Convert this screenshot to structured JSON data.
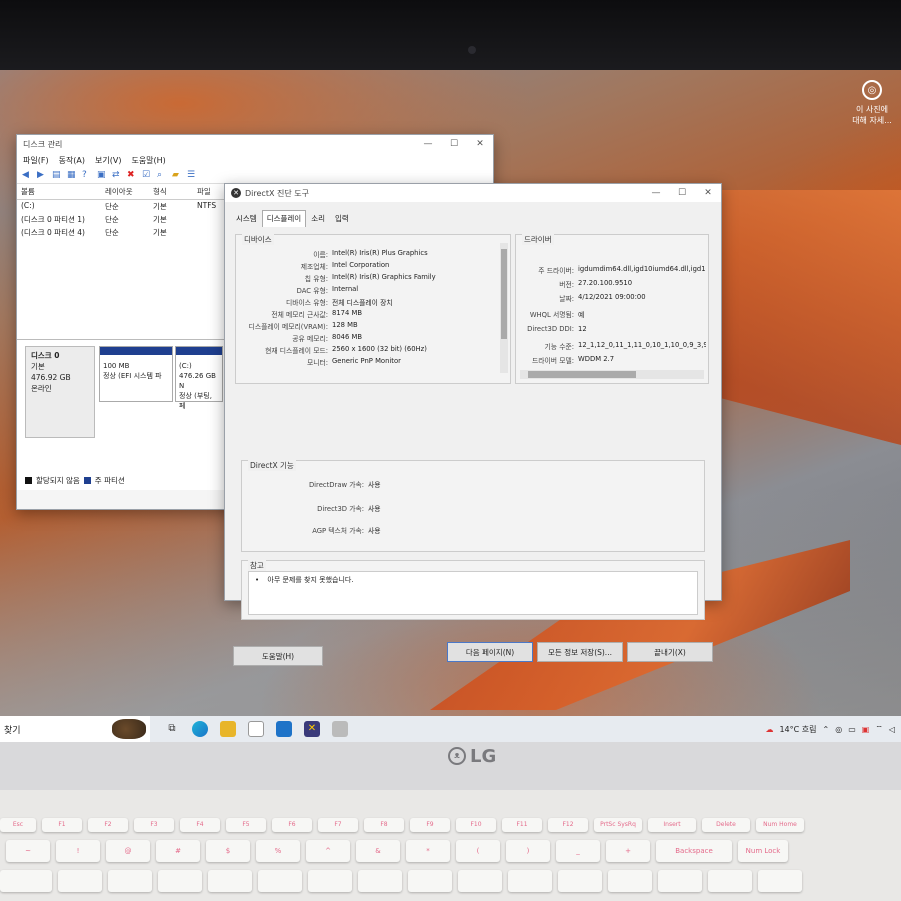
{
  "photo_overlay": {
    "line1": "이 사진에",
    "line2": "대해 자세..."
  },
  "disk_window": {
    "title": "디스크 관리",
    "menu": [
      "파일(F)",
      "동작(A)",
      "보기(V)",
      "도움말(H)"
    ],
    "columns": [
      "볼륨",
      "레이아웃",
      "형식",
      "파일"
    ],
    "rows": [
      [
        "(C:)",
        "단순",
        "기본",
        "NTFS"
      ],
      [
        "(디스크 0 파티션 1)",
        "단순",
        "기본",
        ""
      ],
      [
        "(디스크 0 파티션 4)",
        "단순",
        "기본",
        ""
      ]
    ],
    "disk": {
      "name": "디스크 0",
      "type": "기본",
      "size": "476.92 GB",
      "status": "온라인"
    },
    "partitions": [
      {
        "name": "",
        "size": "100 MB",
        "status": "정상 (EFI 시스템 파"
      },
      {
        "name": "(C:)",
        "size": "476.26 GB N",
        "status": "정상 (부팅, 페"
      }
    ],
    "legend": [
      "할당되지 않음",
      "주 파티션"
    ]
  },
  "dx_window": {
    "title": "DirectX 진단 도구",
    "tabs": [
      "시스템",
      "디스플레이",
      "소리",
      "입력"
    ],
    "device_group": "디바이스",
    "device": [
      [
        "이름:",
        "Intel(R) Iris(R) Plus Graphics"
      ],
      [
        "제조업체:",
        "Intel Corporation"
      ],
      [
        "칩 유형:",
        "Intel(R) Iris(R) Graphics Family"
      ],
      [
        "DAC 유형:",
        "Internal"
      ],
      [
        "디바이스 유형:",
        "전체 디스플레이 장치"
      ],
      [
        "전체 메모리 근사값:",
        "8174 MB"
      ],
      [
        "디스플레이 메모리(VRAM):",
        "128 MB"
      ],
      [
        "공유 메모리:",
        "8046 MB"
      ],
      [
        "현재 디스플레이 모드:",
        "2560 x 1600 (32 bit) (60Hz)"
      ],
      [
        "모니터:",
        "Generic PnP Monitor"
      ]
    ],
    "driver_group": "드라이버",
    "driver": [
      [
        "주 드라이버:",
        "igdumdim64.dll,igd10iumd64.dll,igd10"
      ],
      [
        "버전:",
        "27.20.100.9510"
      ],
      [
        "날짜:",
        "4/12/2021 09:00:00"
      ],
      [
        "WHQL 서명됨:",
        "예"
      ],
      [
        "Direct3D DDI:",
        "12"
      ],
      [
        "기능 수준:",
        "12_1,12_0,11_1,11_0,10_1,10_0,9_3,9_"
      ],
      [
        "드라이버 모델:",
        "WDDM 2.7"
      ]
    ],
    "features_group": "DirectX 기능",
    "features": [
      [
        "DirectDraw 가속:",
        "사용"
      ],
      [
        "Direct3D 가속:",
        "사용"
      ],
      [
        "AGP 텍스처 가속:",
        "사용"
      ]
    ],
    "notes_group": "참고",
    "notes": "아무 문제를 찾지 못했습니다.",
    "buttons": {
      "help": "도움말(H)",
      "next": "다음 페이지(N)",
      "save": "모든 정보 저장(S)...",
      "exit": "끝내기(X)"
    }
  },
  "taskbar": {
    "search": "찾기",
    "weather": "14°C 흐림"
  },
  "brand": "LG",
  "keys_fn": [
    "Esc",
    "F1",
    "F2",
    "F3",
    "F4",
    "F5",
    "F6",
    "F7",
    "F8",
    "F9",
    "F10",
    "F11",
    "F12",
    "PrtSc SysRq",
    "Insert",
    "Delete",
    "Num Home"
  ],
  "keys_num": [
    "~",
    "!",
    "@",
    "#",
    "$",
    "%",
    "^",
    "&",
    "*",
    "(",
    ")",
    "_",
    "+",
    "Backspace",
    "Num Lock"
  ]
}
